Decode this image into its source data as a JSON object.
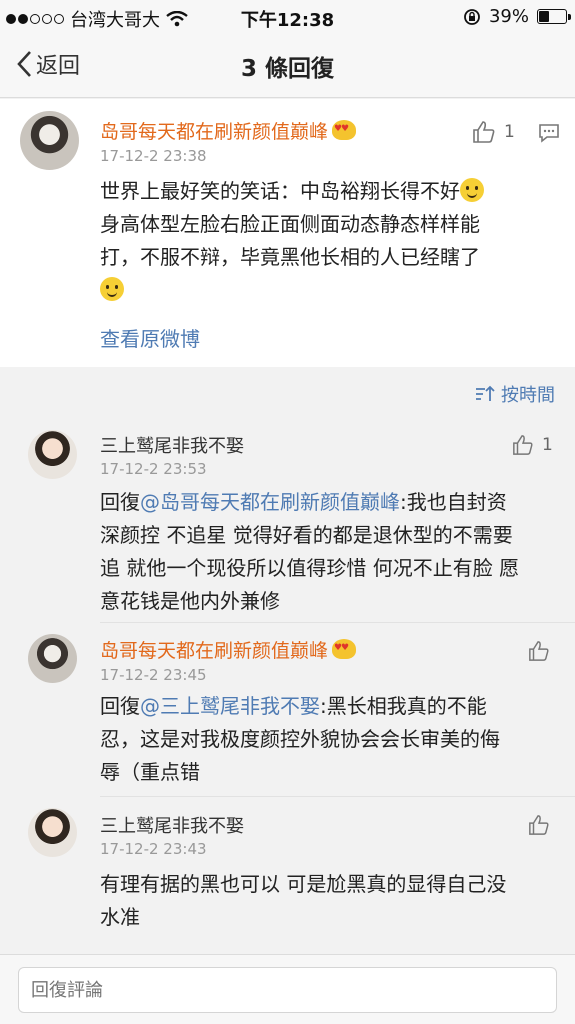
{
  "status_bar": {
    "carrier": "台湾大哥大",
    "time": "下午12:38",
    "battery": "39%",
    "battery_level": 0.39
  },
  "nav": {
    "back_label": "返回",
    "title": "3 條回復"
  },
  "original_post": {
    "author": "岛哥每天都在刷新颜值巅峰",
    "time": "17-12-2 23:38",
    "likes": "1",
    "text_line1": "世界上最好笑的笑话：中岛裕翔长得不好",
    "text_line2": "身高体型左脸右脸正面侧面动态静态样样能",
    "text_line3": "打，不服不辩，毕竟黑他长相的人已经瞎了",
    "view_original": "查看原微博"
  },
  "sort_label": "按時間",
  "replies": [
    {
      "author": "三上鹫尾非我不娶",
      "time": "17-12-2 23:53",
      "likes": "1",
      "prefix": "回復",
      "mention": "@岛哥每天都在刷新颜值巅峰",
      "line1": ":我也自封资",
      "line2": "深颜控 不追星 觉得好看的都是退休型的不需要",
      "line3": "追 就他一个现役所以值得珍惜 何况不止有脸 愿",
      "line4": "意花钱是他内外兼修"
    },
    {
      "author": "岛哥每天都在刷新颜值巅峰",
      "time": "17-12-2 23:45",
      "prefix": "回復",
      "mention": "@三上鹫尾非我不娶",
      "line1": ":黑长相我真的不能",
      "line2": "忍，这是对我极度颜控外貌协会会长审美的侮",
      "line3": "辱（重点错"
    },
    {
      "author": "三上鹫尾非我不娶",
      "time": "17-12-2 23:43",
      "line1": "有理有据的黑也可以 可是尬黑真的显得自己没",
      "line2": "水准"
    }
  ],
  "input": {
    "placeholder": "回復評論"
  },
  "colors": {
    "author_orange": "#e2691c",
    "link_blue": "#4f7bb3"
  },
  "icons": [
    "signal-dots-icon",
    "wifi-icon",
    "rotation-lock-icon",
    "battery-icon",
    "back-chevron-icon",
    "thumbs-up-icon",
    "comment-icon",
    "sort-icon",
    "smile-emoji-icon",
    "thinking-emoji-icon",
    "crown-emoji-icon"
  ]
}
